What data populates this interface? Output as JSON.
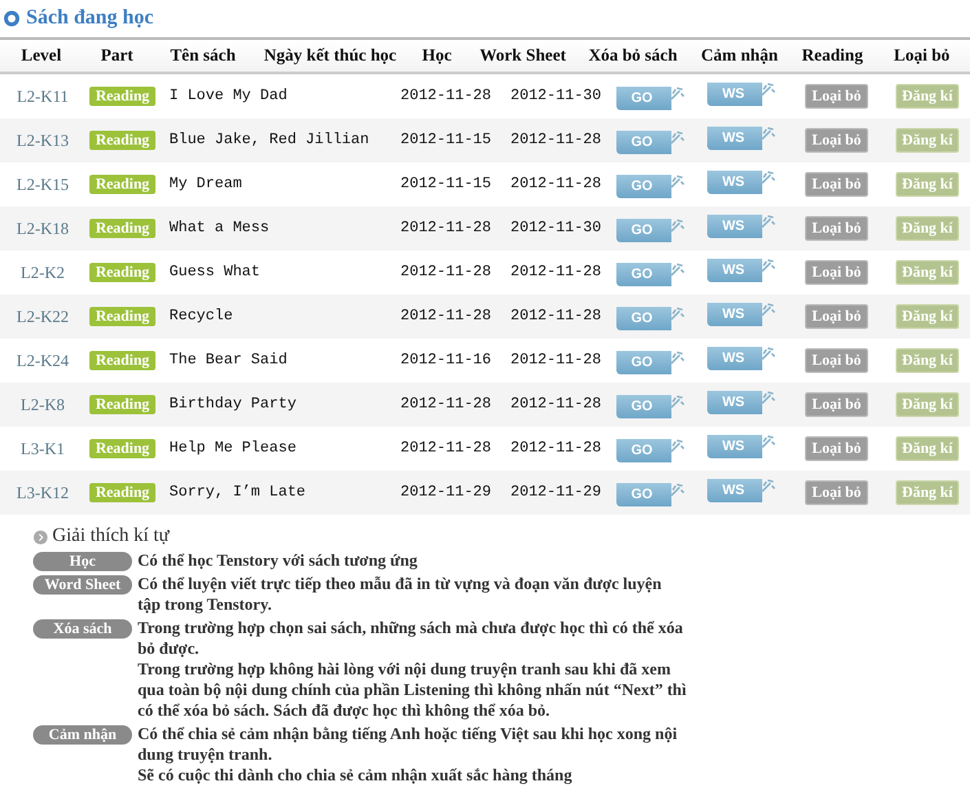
{
  "section_title": "Sách đang học",
  "columns": [
    "Level",
    "Part",
    "Tên sách",
    "Ngày kết thúc học",
    "Học",
    "Work Sheet",
    "Xóa bỏ sách",
    "Cảm nhận",
    "Reading",
    "Loại bỏ"
  ],
  "rows": [
    {
      "level": "L2-K11",
      "part": "Reading",
      "title": "I Love My Dad",
      "date_1": "2012-11-28",
      "date_2": "2012-11-30",
      "go": "GO",
      "ws": "WS",
      "remove": "Loại bỏ",
      "register": "Đăng kí"
    },
    {
      "level": "L2-K13",
      "part": "Reading",
      "title": "Blue Jake, Red Jillian",
      "date_1": "2012-11-15",
      "date_2": "2012-11-28",
      "go": "GO",
      "ws": "WS",
      "remove": "Loại bỏ",
      "register": "Đăng kí"
    },
    {
      "level": "L2-K15",
      "part": "Reading",
      "title": "My Dream",
      "date_1": "2012-11-15",
      "date_2": "2012-11-28",
      "go": "GO",
      "ws": "WS",
      "remove": "Loại bỏ",
      "register": "Đăng kí"
    },
    {
      "level": "L2-K18",
      "part": "Reading",
      "title": "What a Mess",
      "date_1": "2012-11-28",
      "date_2": "2012-11-30",
      "go": "GO",
      "ws": "WS",
      "remove": "Loại bỏ",
      "register": "Đăng kí"
    },
    {
      "level": "L2-K2",
      "part": "Reading",
      "title": "Guess What",
      "date_1": "2012-11-28",
      "date_2": "2012-11-28",
      "go": "GO",
      "ws": "WS",
      "remove": "Loại bỏ",
      "register": "Đăng kí"
    },
    {
      "level": "L2-K22",
      "part": "Reading",
      "title": "Recycle",
      "date_1": "2012-11-28",
      "date_2": "2012-11-28",
      "go": "GO",
      "ws": "WS",
      "remove": "Loại bỏ",
      "register": "Đăng kí"
    },
    {
      "level": "L2-K24",
      "part": "Reading",
      "title": "The Bear Said",
      "date_1": "2012-11-16",
      "date_2": "2012-11-28",
      "go": "GO",
      "ws": "WS",
      "remove": "Loại bỏ",
      "register": "Đăng kí"
    },
    {
      "level": "L2-K8",
      "part": "Reading",
      "title": "Birthday Party",
      "date_1": "2012-11-28",
      "date_2": "2012-11-28",
      "go": "GO",
      "ws": "WS",
      "remove": "Loại bỏ",
      "register": "Đăng kí"
    },
    {
      "level": "L3-K1",
      "part": "Reading",
      "title": "Help Me Please",
      "date_1": "2012-11-28",
      "date_2": "2012-11-28",
      "go": "GO",
      "ws": "WS",
      "remove": "Loại bỏ",
      "register": "Đăng kí"
    },
    {
      "level": "L3-K12",
      "part": "Reading",
      "title": "Sorry, I’m Late",
      "date_1": "2012-11-29",
      "date_2": "2012-11-29",
      "go": "GO",
      "ws": "WS",
      "remove": "Loại bỏ",
      "register": "Đăng kí"
    }
  ],
  "legend": {
    "title": "Giải thích kí tự",
    "items": [
      {
        "badge": "Học",
        "paragraphs": [
          "Có thể học Tenstory với sách tương ứng"
        ]
      },
      {
        "badge": "Word Sheet",
        "paragraphs": [
          "Có thể luyện viết trực tiếp theo mẫu đã in từ vựng và đoạn văn được luyện tập trong Tenstory."
        ]
      },
      {
        "badge": "Xóa sách",
        "paragraphs": [
          "Trong trường hợp chọn sai sách, những sách mà chưa được học thì có thể xóa bỏ được.",
          "Trong trường hợp không hài lòng với nội dung truyện tranh sau khi đã xem qua toàn bộ nội dung chính của phần Listening thì không nhấn nút “Next” thì có thể xóa bỏ sách. Sách đã được học thì không thể xóa bỏ."
        ]
      },
      {
        "badge": "Cảm nhận",
        "paragraphs": [
          "Có thể chia sẻ cảm nhận bằng tiếng Anh hoặc tiếng Việt sau khi học xong nội dung truyện tranh.",
          "Sẽ có cuộc thi dành cho chia sẻ cảm nhận xuất sắc hàng tháng"
        ]
      }
    ]
  }
}
